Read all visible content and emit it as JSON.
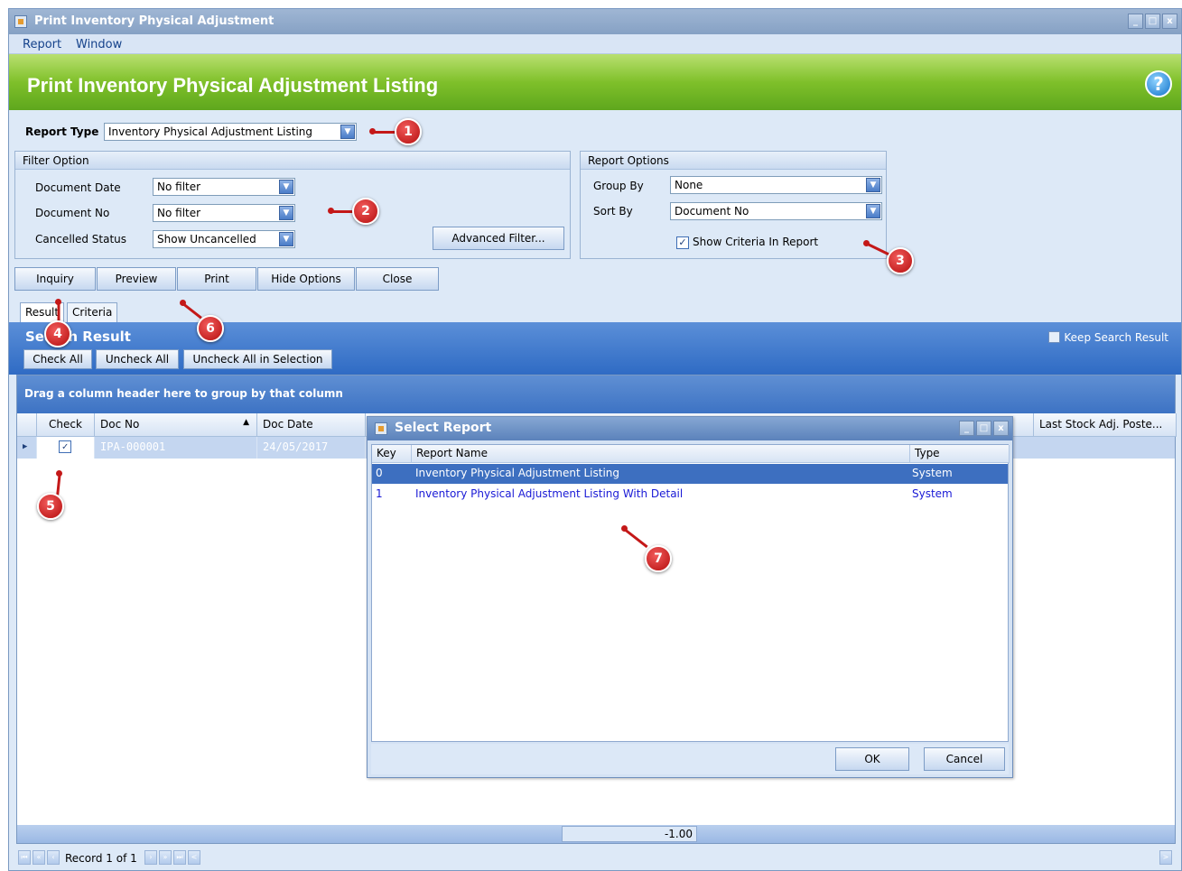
{
  "window": {
    "title": "Print Inventory Physical Adjustment"
  },
  "menu": [
    "Report",
    "Window"
  ],
  "banner": {
    "title": "Print Inventory Physical Adjustment Listing"
  },
  "report_type": {
    "label": "Report Type",
    "value": "Inventory Physical Adjustment Listing"
  },
  "filter_option": {
    "title": "Filter Option",
    "document_date": {
      "label": "Document Date",
      "value": "No filter"
    },
    "document_no": {
      "label": "Document No",
      "value": "No filter"
    },
    "cancelled_status": {
      "label": "Cancelled Status",
      "value": "Show Uncancelled"
    },
    "advanced_filter": "Advanced Filter..."
  },
  "report_options": {
    "title": "Report Options",
    "group_by": {
      "label": "Group By",
      "value": "None"
    },
    "sort_by": {
      "label": "Sort By",
      "value": "Document No"
    },
    "show_criteria": {
      "label": "Show Criteria In Report",
      "checked": true
    }
  },
  "actions": [
    "Inquiry",
    "Preview",
    "Print",
    "Hide Options",
    "Close"
  ],
  "tabs": [
    "Result",
    "Criteria"
  ],
  "search_result": {
    "title": "Search Result",
    "buttons": [
      "Check All",
      "Uncheck All",
      "Uncheck All in Selection"
    ],
    "keep_label": "Keep Search Result"
  },
  "grid": {
    "group_hint": "Drag a column header here to group by that column",
    "columns": {
      "check": "Check",
      "doc_no": "Doc No",
      "doc_date": "Doc Date",
      "last_stock": "Last Stock Adj. Poste..."
    },
    "rows": [
      {
        "checked": true,
        "doc_no": "IPA-000001",
        "doc_date": "24/05/2017"
      }
    ],
    "footer_sum": "-1.00"
  },
  "navigator": {
    "record_text": "Record 1 of 1"
  },
  "dialog": {
    "title": "Select Report",
    "columns": {
      "key": "Key",
      "name": "Report Name",
      "type": "Type"
    },
    "rows": [
      {
        "key": "0",
        "name": "Inventory Physical Adjustment Listing",
        "type": "System"
      },
      {
        "key": "1",
        "name": "Inventory Physical Adjustment Listing With Detail",
        "type": "System"
      }
    ],
    "ok": "OK",
    "cancel": "Cancel"
  },
  "markers": [
    "1",
    "2",
    "3",
    "4",
    "5",
    "6",
    "7"
  ],
  "colors": {
    "accent_green": "#7fc02a",
    "accent_blue": "#2f6bc4",
    "marker_red": "#c41818"
  }
}
